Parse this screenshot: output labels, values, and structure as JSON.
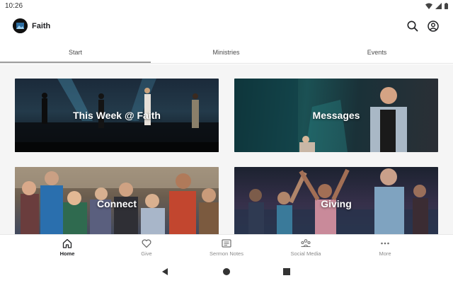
{
  "status_bar": {
    "time": "10:26",
    "icons": [
      "wifi-icon",
      "signal-icon",
      "battery-icon"
    ]
  },
  "app_bar": {
    "title": "Faith",
    "actions": [
      "search-icon",
      "account-icon"
    ]
  },
  "tabs": [
    {
      "label": "Start",
      "selected": true
    },
    {
      "label": "Ministries",
      "selected": false
    },
    {
      "label": "Events",
      "selected": false
    }
  ],
  "cards": [
    {
      "label": "This Week @ Faith"
    },
    {
      "label": "Messages"
    },
    {
      "label": "Connect"
    },
    {
      "label": "Giving"
    }
  ],
  "bottom_nav": [
    {
      "label": "Home",
      "icon": "home-icon",
      "active": true
    },
    {
      "label": "Give",
      "icon": "heart-icon",
      "active": false
    },
    {
      "label": "Sermon Notes",
      "icon": "notes-icon",
      "active": false
    },
    {
      "label": "Social Media",
      "icon": "social-media-icon",
      "active": false
    },
    {
      "label": "More",
      "icon": "more-icon",
      "active": false
    }
  ],
  "system_nav": [
    "back-icon",
    "home-circle-icon",
    "recents-icon"
  ],
  "colors": {
    "background": "#ffffff",
    "content_background": "#f5f5f5",
    "tab_indicator": "#9e9e9e",
    "text_primary": "#202124",
    "text_secondary": "#8a8a8a"
  }
}
